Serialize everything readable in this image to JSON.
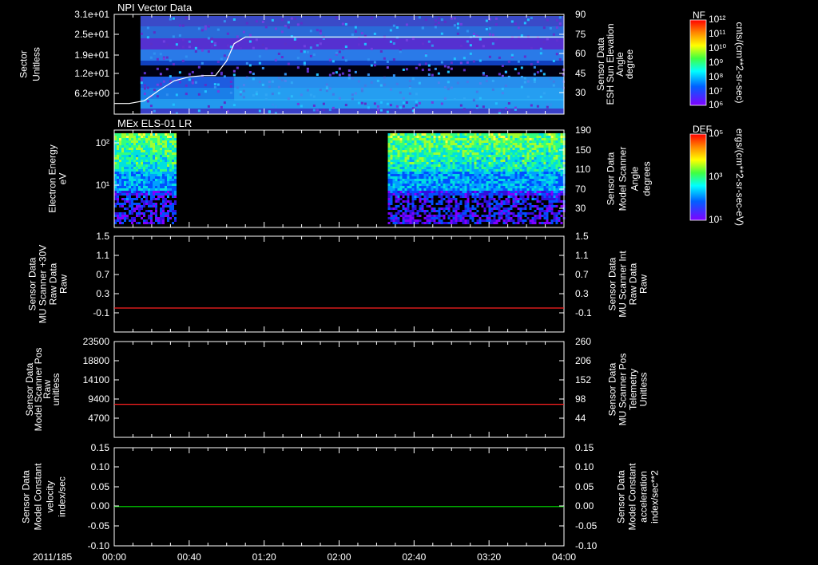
{
  "time_axis": {
    "date_label": "2011/185",
    "tick_labels": [
      "00:00",
      "00:40",
      "01:20",
      "02:00",
      "02:40",
      "03:20",
      "04:00"
    ]
  },
  "colors": {
    "red": "#ff2020",
    "green": "#00e000",
    "white": "#ffffff"
  },
  "colorbar1": {
    "title": "NF",
    "units": "cnts/(cm**2-sr-sec)",
    "ticks": [
      "10¹²",
      "10¹¹",
      "10¹⁰",
      "10⁹",
      "10⁸",
      "10⁷",
      "10⁶"
    ]
  },
  "colorbar2": {
    "title": "DEF",
    "units": "ergs/(cm**2-sr-sec-eV)",
    "ticks": [
      "10⁵",
      "10³",
      "10¹"
    ]
  },
  "chart_data": [
    {
      "type": "heatmap",
      "title": "NPI Vector Data",
      "ylabel": [
        "Sector",
        "Unitless"
      ],
      "yticks": [
        "3.1e+01",
        "2.5e+01",
        "1.9e+01",
        "1.2e+01",
        "6.2e+00"
      ],
      "right_ylabel": [
        "Sensor Data",
        "ESH Sun Elevation",
        "Angle",
        "degree"
      ],
      "right_yticks": [
        "90",
        "75",
        "60",
        "45",
        "30"
      ],
      "right_ylim": [
        15,
        90
      ],
      "overlay_line": {
        "color": "#ffffff",
        "x": [
          "00:00",
          "00:08",
          "00:16",
          "00:24",
          "00:32",
          "00:40",
          "00:48",
          "00:54",
          "01:00",
          "01:04",
          "01:10",
          "04:00"
        ],
        "y": [
          23,
          23,
          25,
          33,
          40,
          43,
          44,
          44,
          55,
          68,
          73,
          73
        ]
      },
      "data_start": "00:14"
    },
    {
      "type": "heatmap",
      "title": "MEx ELS-01 LR",
      "ylabel": [
        "Electron Energy",
        "eV"
      ],
      "yticks": [
        "10²",
        "10¹"
      ],
      "right_ylabel": [
        "Sensor Data",
        "Model Scanner",
        "Angle",
        "degrees"
      ],
      "right_yticks": [
        "190",
        "150",
        "110",
        "70",
        "30"
      ],
      "data_segments": [
        [
          "00:00",
          "00:32"
        ],
        [
          "02:26",
          "04:00"
        ]
      ]
    },
    {
      "type": "line",
      "ylabel": [
        "Sensor Data",
        "MU Scanner +30V",
        "Raw Data",
        "Raw"
      ],
      "yticks": [
        "1.5",
        "1.1",
        "0.7",
        "0.3",
        "-0.1"
      ],
      "ylim": [
        -0.5,
        1.5
      ],
      "right_ylabel": [
        "Sensor Data",
        "MU Scanner Int",
        "Raw Data",
        "Raw"
      ],
      "right_yticks": [
        "1.5",
        "1.1",
        "0.7",
        "0.3",
        "-0.1"
      ],
      "series": [
        {
          "color": "#ff2020",
          "values": [
            0.0,
            0.0
          ]
        }
      ],
      "x": [
        "00:00",
        "04:00"
      ]
    },
    {
      "type": "line",
      "ylabel": [
        "Sensor Data",
        "Model Scanner Pos",
        "Raw",
        "unitless"
      ],
      "yticks": [
        "23500",
        "18800",
        "14100",
        "9400",
        "4700"
      ],
      "ylim": [
        0,
        23500
      ],
      "right_ylabel": [
        "Sensor Data",
        "MU Scanner Pos",
        "Telemetry",
        "Unitless"
      ],
      "right_yticks": [
        "260",
        "206",
        "152",
        "98",
        "44"
      ],
      "series": [
        {
          "color": "#ff2020",
          "values": [
            8100,
            8100
          ]
        }
      ],
      "x": [
        "00:00",
        "04:00"
      ]
    },
    {
      "type": "line",
      "ylabel": [
        "Sensor Data",
        "Model Constant",
        "velocity",
        "index/sec"
      ],
      "yticks": [
        "0.15",
        "0.10",
        "0.05",
        "0.00",
        "-0.05",
        "-0.10"
      ],
      "ylim": [
        -0.1,
        0.15
      ],
      "right_ylabel": [
        "Sensor Data",
        "Model Constant",
        "acceleration",
        "index/sec**2"
      ],
      "right_yticks": [
        "0.15",
        "0.10",
        "0.05",
        "0.00",
        "-0.05",
        "-0.10"
      ],
      "series": [
        {
          "color": "#00e000",
          "values": [
            0.0,
            0.0
          ]
        }
      ],
      "x": [
        "00:00",
        "04:00"
      ]
    }
  ]
}
